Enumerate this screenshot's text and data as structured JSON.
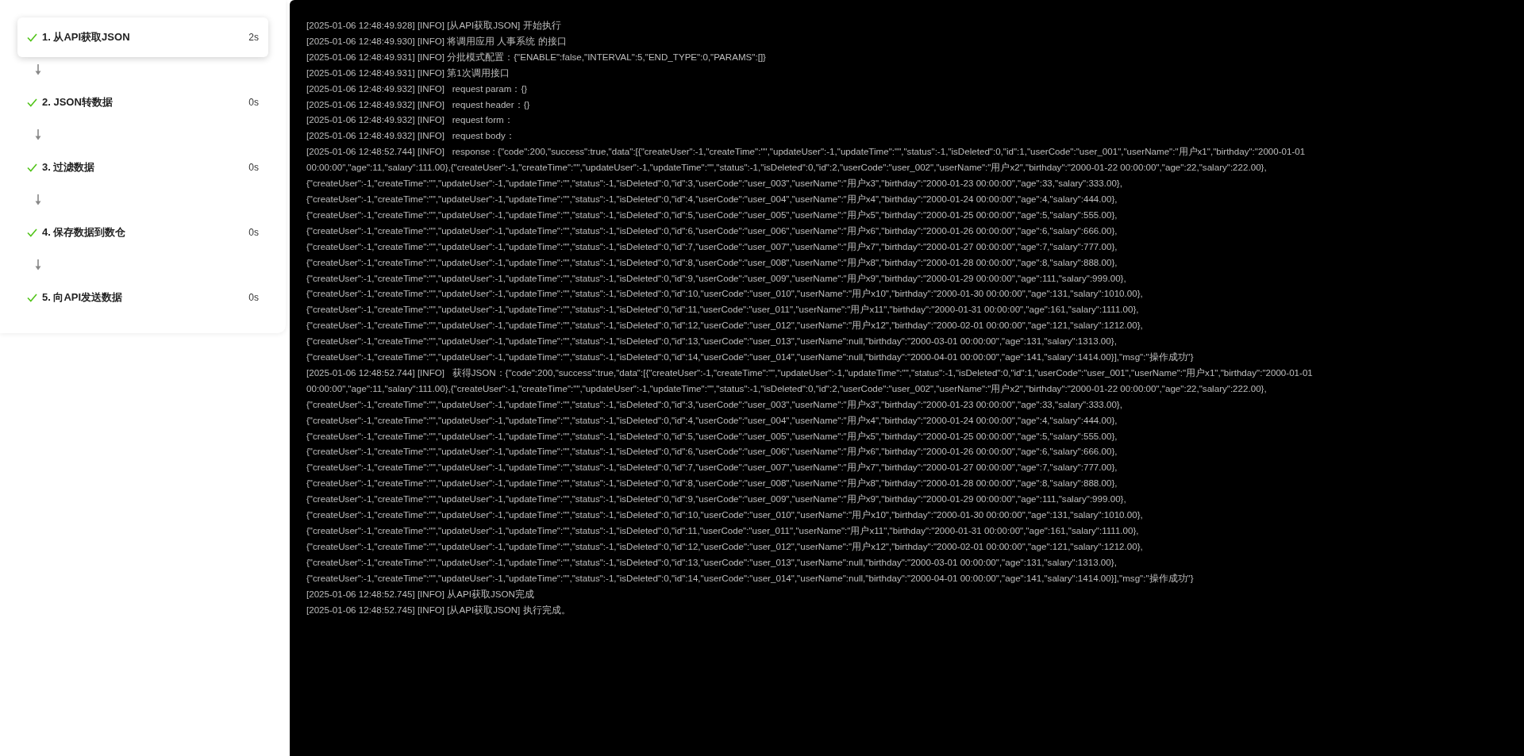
{
  "steps": [
    {
      "label": "1. 从API获取JSON",
      "duration": "2s",
      "done": true,
      "selected": true
    },
    {
      "label": "2. JSON转数据",
      "duration": "0s",
      "done": true,
      "selected": false
    },
    {
      "label": "3. 过滤数据",
      "duration": "0s",
      "done": true,
      "selected": false
    },
    {
      "label": "4. 保存数据到数仓",
      "duration": "0s",
      "done": true,
      "selected": false
    },
    {
      "label": "5. 向API发送数据",
      "duration": "0s",
      "done": true,
      "selected": false
    }
  ],
  "log": [
    "[2025-01-06 12:48:49.928] [INFO] [从API获取JSON] 开始执行",
    "[2025-01-06 12:48:49.930] [INFO] 将调用应用 人事系统 的接口",
    "[2025-01-06 12:48:49.931] [INFO] 分批模式配置：{\"ENABLE\":false,\"INTERVAL\":5,\"END_TYPE\":0,\"PARAMS\":[]}",
    "[2025-01-06 12:48:49.931] [INFO] 第1次调用接口",
    "[2025-01-06 12:48:49.932] [INFO]   request param：{}",
    "[2025-01-06 12:48:49.932] [INFO]   request header：{}",
    "[2025-01-06 12:48:49.932] [INFO]   request form：",
    "[2025-01-06 12:48:49.932] [INFO]   request body：",
    "[2025-01-06 12:48:52.744] [INFO]   response : {\"code\":200,\"success\":true,\"data\":[{\"createUser\":-1,\"createTime\":\"\",\"updateUser\":-1,\"updateTime\":\"\",\"status\":-1,\"isDeleted\":0,\"id\":1,\"userCode\":\"user_001\",\"userName\":\"用户x1\",\"birthday\":\"2000-01-01",
    "00:00:00\",\"age\":11,\"salary\":111.00},{\"createUser\":-1,\"createTime\":\"\",\"updateUser\":-1,\"updateTime\":\"\",\"status\":-1,\"isDeleted\":0,\"id\":2,\"userCode\":\"user_002\",\"userName\":\"用户x2\",\"birthday\":\"2000-01-22 00:00:00\",\"age\":22,\"salary\":222.00},",
    "{\"createUser\":-1,\"createTime\":\"\",\"updateUser\":-1,\"updateTime\":\"\",\"status\":-1,\"isDeleted\":0,\"id\":3,\"userCode\":\"user_003\",\"userName\":\"用户x3\",\"birthday\":\"2000-01-23 00:00:00\",\"age\":33,\"salary\":333.00},",
    "{\"createUser\":-1,\"createTime\":\"\",\"updateUser\":-1,\"updateTime\":\"\",\"status\":-1,\"isDeleted\":0,\"id\":4,\"userCode\":\"user_004\",\"userName\":\"用户x4\",\"birthday\":\"2000-01-24 00:00:00\",\"age\":4,\"salary\":444.00},",
    "{\"createUser\":-1,\"createTime\":\"\",\"updateUser\":-1,\"updateTime\":\"\",\"status\":-1,\"isDeleted\":0,\"id\":5,\"userCode\":\"user_005\",\"userName\":\"用户x5\",\"birthday\":\"2000-01-25 00:00:00\",\"age\":5,\"salary\":555.00},",
    "{\"createUser\":-1,\"createTime\":\"\",\"updateUser\":-1,\"updateTime\":\"\",\"status\":-1,\"isDeleted\":0,\"id\":6,\"userCode\":\"user_006\",\"userName\":\"用户x6\",\"birthday\":\"2000-01-26 00:00:00\",\"age\":6,\"salary\":666.00},",
    "{\"createUser\":-1,\"createTime\":\"\",\"updateUser\":-1,\"updateTime\":\"\",\"status\":-1,\"isDeleted\":0,\"id\":7,\"userCode\":\"user_007\",\"userName\":\"用户x7\",\"birthday\":\"2000-01-27 00:00:00\",\"age\":7,\"salary\":777.00},",
    "{\"createUser\":-1,\"createTime\":\"\",\"updateUser\":-1,\"updateTime\":\"\",\"status\":-1,\"isDeleted\":0,\"id\":8,\"userCode\":\"user_008\",\"userName\":\"用户x8\",\"birthday\":\"2000-01-28 00:00:00\",\"age\":8,\"salary\":888.00},",
    "{\"createUser\":-1,\"createTime\":\"\",\"updateUser\":-1,\"updateTime\":\"\",\"status\":-1,\"isDeleted\":0,\"id\":9,\"userCode\":\"user_009\",\"userName\":\"用户x9\",\"birthday\":\"2000-01-29 00:00:00\",\"age\":111,\"salary\":999.00},",
    "{\"createUser\":-1,\"createTime\":\"\",\"updateUser\":-1,\"updateTime\":\"\",\"status\":-1,\"isDeleted\":0,\"id\":10,\"userCode\":\"user_010\",\"userName\":\"用户x10\",\"birthday\":\"2000-01-30 00:00:00\",\"age\":131,\"salary\":1010.00},",
    "{\"createUser\":-1,\"createTime\":\"\",\"updateUser\":-1,\"updateTime\":\"\",\"status\":-1,\"isDeleted\":0,\"id\":11,\"userCode\":\"user_011\",\"userName\":\"用户x11\",\"birthday\":\"2000-01-31 00:00:00\",\"age\":161,\"salary\":1111.00},",
    "{\"createUser\":-1,\"createTime\":\"\",\"updateUser\":-1,\"updateTime\":\"\",\"status\":-1,\"isDeleted\":0,\"id\":12,\"userCode\":\"user_012\",\"userName\":\"用户x12\",\"birthday\":\"2000-02-01 00:00:00\",\"age\":121,\"salary\":1212.00},",
    "{\"createUser\":-1,\"createTime\":\"\",\"updateUser\":-1,\"updateTime\":\"\",\"status\":-1,\"isDeleted\":0,\"id\":13,\"userCode\":\"user_013\",\"userName\":null,\"birthday\":\"2000-03-01 00:00:00\",\"age\":131,\"salary\":1313.00},",
    "{\"createUser\":-1,\"createTime\":\"\",\"updateUser\":-1,\"updateTime\":\"\",\"status\":-1,\"isDeleted\":0,\"id\":14,\"userCode\":\"user_014\",\"userName\":null,\"birthday\":\"2000-04-01 00:00:00\",\"age\":141,\"salary\":1414.00}],\"msg\":\"操作成功\"}",
    "[2025-01-06 12:48:52.744] [INFO]   获得JSON：{\"code\":200,\"success\":true,\"data\":[{\"createUser\":-1,\"createTime\":\"\",\"updateUser\":-1,\"updateTime\":\"\",\"status\":-1,\"isDeleted\":0,\"id\":1,\"userCode\":\"user_001\",\"userName\":\"用户x1\",\"birthday\":\"2000-01-01",
    "00:00:00\",\"age\":11,\"salary\":111.00},{\"createUser\":-1,\"createTime\":\"\",\"updateUser\":-1,\"updateTime\":\"\",\"status\":-1,\"isDeleted\":0,\"id\":2,\"userCode\":\"user_002\",\"userName\":\"用户x2\",\"birthday\":\"2000-01-22 00:00:00\",\"age\":22,\"salary\":222.00},",
    "{\"createUser\":-1,\"createTime\":\"\",\"updateUser\":-1,\"updateTime\":\"\",\"status\":-1,\"isDeleted\":0,\"id\":3,\"userCode\":\"user_003\",\"userName\":\"用户x3\",\"birthday\":\"2000-01-23 00:00:00\",\"age\":33,\"salary\":333.00},",
    "{\"createUser\":-1,\"createTime\":\"\",\"updateUser\":-1,\"updateTime\":\"\",\"status\":-1,\"isDeleted\":0,\"id\":4,\"userCode\":\"user_004\",\"userName\":\"用户x4\",\"birthday\":\"2000-01-24 00:00:00\",\"age\":4,\"salary\":444.00},",
    "{\"createUser\":-1,\"createTime\":\"\",\"updateUser\":-1,\"updateTime\":\"\",\"status\":-1,\"isDeleted\":0,\"id\":5,\"userCode\":\"user_005\",\"userName\":\"用户x5\",\"birthday\":\"2000-01-25 00:00:00\",\"age\":5,\"salary\":555.00},",
    "{\"createUser\":-1,\"createTime\":\"\",\"updateUser\":-1,\"updateTime\":\"\",\"status\":-1,\"isDeleted\":0,\"id\":6,\"userCode\":\"user_006\",\"userName\":\"用户x6\",\"birthday\":\"2000-01-26 00:00:00\",\"age\":6,\"salary\":666.00},",
    "{\"createUser\":-1,\"createTime\":\"\",\"updateUser\":-1,\"updateTime\":\"\",\"status\":-1,\"isDeleted\":0,\"id\":7,\"userCode\":\"user_007\",\"userName\":\"用户x7\",\"birthday\":\"2000-01-27 00:00:00\",\"age\":7,\"salary\":777.00},",
    "{\"createUser\":-1,\"createTime\":\"\",\"updateUser\":-1,\"updateTime\":\"\",\"status\":-1,\"isDeleted\":0,\"id\":8,\"userCode\":\"user_008\",\"userName\":\"用户x8\",\"birthday\":\"2000-01-28 00:00:00\",\"age\":8,\"salary\":888.00},",
    "{\"createUser\":-1,\"createTime\":\"\",\"updateUser\":-1,\"updateTime\":\"\",\"status\":-1,\"isDeleted\":0,\"id\":9,\"userCode\":\"user_009\",\"userName\":\"用户x9\",\"birthday\":\"2000-01-29 00:00:00\",\"age\":111,\"salary\":999.00},",
    "{\"createUser\":-1,\"createTime\":\"\",\"updateUser\":-1,\"updateTime\":\"\",\"status\":-1,\"isDeleted\":0,\"id\":10,\"userCode\":\"user_010\",\"userName\":\"用户x10\",\"birthday\":\"2000-01-30 00:00:00\",\"age\":131,\"salary\":1010.00},",
    "{\"createUser\":-1,\"createTime\":\"\",\"updateUser\":-1,\"updateTime\":\"\",\"status\":-1,\"isDeleted\":0,\"id\":11,\"userCode\":\"user_011\",\"userName\":\"用户x11\",\"birthday\":\"2000-01-31 00:00:00\",\"age\":161,\"salary\":1111.00},",
    "{\"createUser\":-1,\"createTime\":\"\",\"updateUser\":-1,\"updateTime\":\"\",\"status\":-1,\"isDeleted\":0,\"id\":12,\"userCode\":\"user_012\",\"userName\":\"用户x12\",\"birthday\":\"2000-02-01 00:00:00\",\"age\":121,\"salary\":1212.00},",
    "{\"createUser\":-1,\"createTime\":\"\",\"updateUser\":-1,\"updateTime\":\"\",\"status\":-1,\"isDeleted\":0,\"id\":13,\"userCode\":\"user_013\",\"userName\":null,\"birthday\":\"2000-03-01 00:00:00\",\"age\":131,\"salary\":1313.00},",
    "{\"createUser\":-1,\"createTime\":\"\",\"updateUser\":-1,\"updateTime\":\"\",\"status\":-1,\"isDeleted\":0,\"id\":14,\"userCode\":\"user_014\",\"userName\":null,\"birthday\":\"2000-04-01 00:00:00\",\"age\":141,\"salary\":1414.00}],\"msg\":\"操作成功\"}",
    "[2025-01-06 12:48:52.745] [INFO] 从API获取JSON完成",
    "[2025-01-06 12:48:52.745] [INFO] [从API获取JSON] 执行完成。"
  ]
}
